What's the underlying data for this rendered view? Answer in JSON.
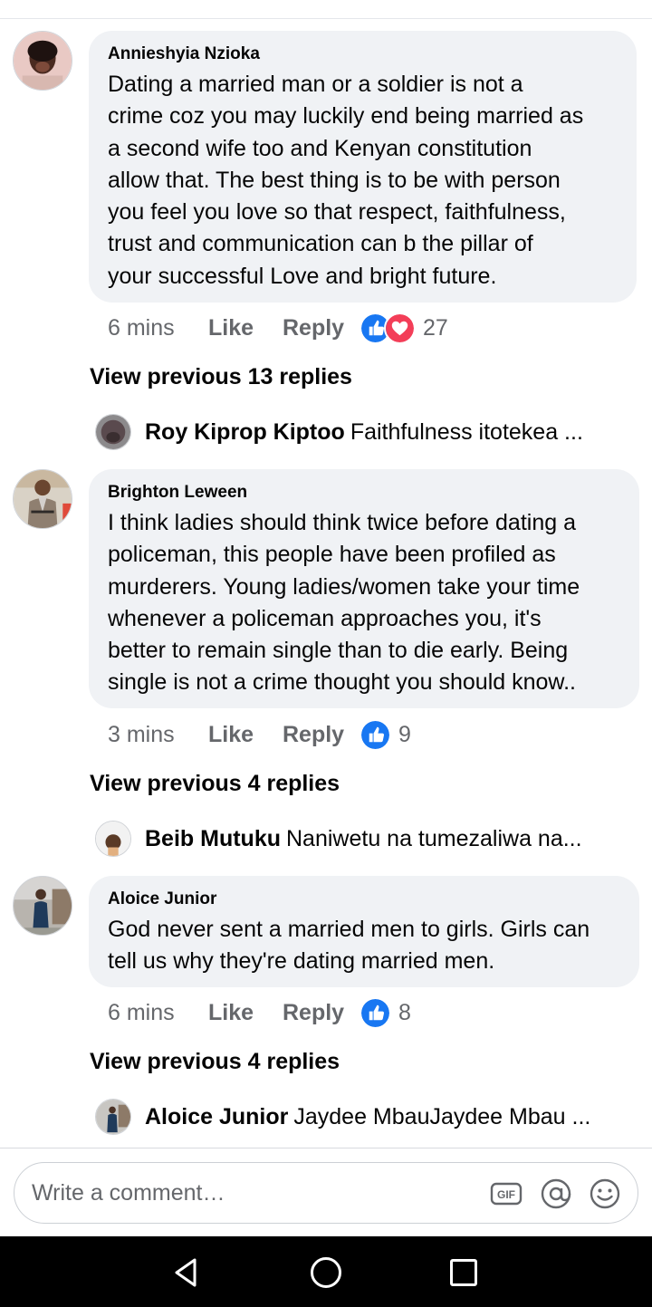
{
  "comments": [
    {
      "author": "Annieshyia Nzioka",
      "text": "Dating a married man or a soldier is not a\ncrime coz you may luckily end being married as\na second wife too and Kenyan constitution\nallow that. The best thing is to be with person\nyou feel you love so that respect, faithfulness,\ntrust and communication can b the pillar of\nyour successful Love and bright future.",
      "time": "6 mins",
      "like_label": "Like",
      "reply_label": "Reply",
      "reaction_count": "27",
      "reactions": [
        "like-icon",
        "love-icon"
      ],
      "view_previous": "View previous 13 replies",
      "latest_reply": {
        "name": "Roy Kiprop Kiptoo",
        "text": "Faithfulness itotekea ..."
      }
    },
    {
      "author": "Brighton Leween",
      "text": "I think ladies should think twice before dating a\npoliceman, this people have been profiled as\nmurderers. Young ladies/women take your time\nwhenever a policeman approaches you, it's\nbetter to remain single than to die early. Being\nsingle is not a crime thought you should know..",
      "time": "3 mins",
      "like_label": "Like",
      "reply_label": "Reply",
      "reaction_count": "9",
      "reactions": [
        "like-icon"
      ],
      "view_previous": "View previous 4 replies",
      "latest_reply": {
        "name": "Beib Mutuku",
        "text": "Naniwetu na tumezaliwa na..."
      }
    },
    {
      "author": "Aloice Junior",
      "text": "God never sent a married men to girls. Girls can\ntell us why they're dating married men.",
      "time": "6 mins",
      "like_label": "Like",
      "reply_label": "Reply",
      "reaction_count": "8",
      "reactions": [
        "like-icon"
      ],
      "view_previous": "View previous 4 replies",
      "latest_reply": {
        "name": "Aloice Junior",
        "text": "Jaydee MbauJaydee Mbau ..."
      }
    }
  ],
  "composer": {
    "placeholder": "Write a comment…",
    "icons": [
      "gif-icon",
      "mention-icon",
      "emoji-icon"
    ]
  },
  "navbar": {
    "icons": [
      "back-icon",
      "home-icon",
      "recents-icon"
    ]
  },
  "colors": {
    "like_blue": "#1877f2",
    "love_red": "#f33e58",
    "bubble_gray": "#f0f2f5",
    "meta_gray": "#65676b"
  }
}
